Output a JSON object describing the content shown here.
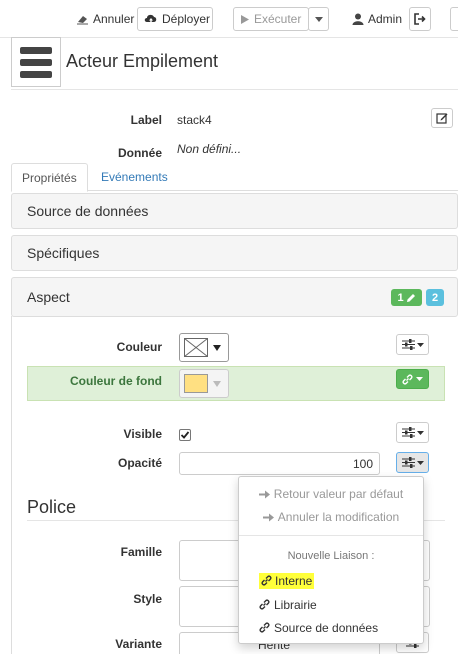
{
  "toolbar": {
    "annuler": "Annuler",
    "deployer": "Déployer",
    "executer": "Exécuter",
    "admin": "Admin"
  },
  "header": {
    "title": "Acteur Empilement"
  },
  "properties": {
    "label_label": "Label",
    "label_value": "stack4",
    "donnee_label": "Donnée",
    "donnee_value": "Non défini..."
  },
  "tabs": {
    "proprietes": "Propriétés",
    "evenements": "Evénements"
  },
  "panels": {
    "source": "Source de données",
    "specifiques": "Spécifiques",
    "aspect": "Aspect",
    "badge_green": "1",
    "badge_blue": "2"
  },
  "aspect": {
    "couleur_label": "Couleur",
    "couleur_fond_label": "Couleur de fond",
    "couleur_fond_value": "#ffe082",
    "visible_label": "Visible",
    "opacite_label": "Opacité",
    "opacite_value": "100"
  },
  "police": {
    "title": "Police",
    "famille_label": "Famille",
    "style_label": "Style",
    "variante_label": "Variante",
    "variante_value": "Hérité"
  },
  "menu": {
    "reset": "Retour valeur par défaut",
    "cancel": "Annuler la modification",
    "header": "Nouvelle Liaison :",
    "interne": "Interne",
    "librairie": "Librairie",
    "source": "Source de données"
  },
  "colors": {
    "accent_link": "#337ab7",
    "badge_green": "#5cb85c",
    "badge_blue": "#5bc0de",
    "row_highlight": "#dff0d8",
    "text_highlight": "#ffff3a"
  }
}
